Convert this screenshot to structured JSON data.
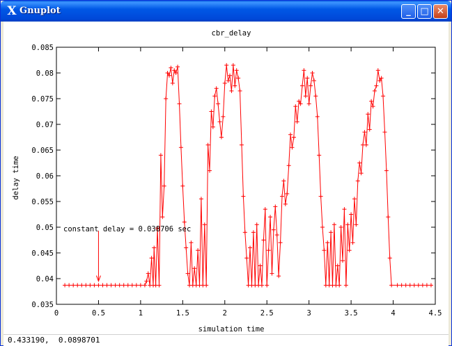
{
  "window": {
    "title": "Gnuplot",
    "app_icon": "x-window-icon",
    "controls": {
      "minimize": "minimize-icon",
      "maximize": "maximize-icon",
      "close": "close-icon"
    }
  },
  "status_bar": {
    "coordinates": "0.433190,  0.0898701"
  },
  "colors": {
    "series": "#ff0000",
    "titlebar": "#0054e3"
  },
  "chart_data": {
    "type": "line",
    "title": "cbr_delay",
    "xlabel": "simulation time",
    "ylabel": "delay time",
    "xlim": [
      0,
      4.5
    ],
    "ylim": [
      0.035,
      0.085
    ],
    "xticks": [
      "0",
      "0.5",
      "1",
      "1.5",
      "2",
      "2.5",
      "3",
      "3.5",
      "4",
      "4.5"
    ],
    "yticks": [
      "0.035",
      "0.04",
      "0.045",
      "0.05",
      "0.055",
      "0.06",
      "0.065",
      "0.07",
      "0.075",
      "0.08",
      "0.085"
    ],
    "grid": false,
    "markers": "plus",
    "annotation": {
      "text": "constant delay = 0.038706 sec",
      "arrow_to": [
        0.5,
        0.0395
      ],
      "arrow_from": [
        0.5,
        0.0493
      ]
    },
    "series": [
      {
        "values": [
          [
            0.1,
            0.03871
          ],
          [
            0.15,
            0.03871
          ],
          [
            0.2,
            0.03871
          ],
          [
            0.25,
            0.03871
          ],
          [
            0.3,
            0.03871
          ],
          [
            0.35,
            0.03871
          ],
          [
            0.4,
            0.03871
          ],
          [
            0.45,
            0.03871
          ],
          [
            0.5,
            0.03871
          ],
          [
            0.55,
            0.03871
          ],
          [
            0.6,
            0.03871
          ],
          [
            0.65,
            0.03871
          ],
          [
            0.7,
            0.03871
          ],
          [
            0.75,
            0.03871
          ],
          [
            0.8,
            0.03871
          ],
          [
            0.85,
            0.03871
          ],
          [
            0.9,
            0.03871
          ],
          [
            0.95,
            0.03871
          ],
          [
            1.0,
            0.03871
          ],
          [
            1.05,
            0.03871
          ],
          [
            1.07,
            0.0395
          ],
          [
            1.09,
            0.041
          ],
          [
            1.11,
            0.0387
          ],
          [
            1.13,
            0.044
          ],
          [
            1.15,
            0.0387
          ],
          [
            1.16,
            0.046
          ],
          [
            1.18,
            0.0387
          ],
          [
            1.2,
            0.0498
          ],
          [
            1.22,
            0.0387
          ],
          [
            1.24,
            0.064
          ],
          [
            1.26,
            0.052
          ],
          [
            1.28,
            0.058
          ],
          [
            1.3,
            0.075
          ],
          [
            1.32,
            0.08
          ],
          [
            1.34,
            0.0795
          ],
          [
            1.36,
            0.081
          ],
          [
            1.38,
            0.078
          ],
          [
            1.4,
            0.0805
          ],
          [
            1.42,
            0.08
          ],
          [
            1.44,
            0.0812
          ],
          [
            1.46,
            0.074
          ],
          [
            1.48,
            0.0655
          ],
          [
            1.5,
            0.058
          ],
          [
            1.52,
            0.051
          ],
          [
            1.54,
            0.046
          ],
          [
            1.56,
            0.041
          ],
          [
            1.58,
            0.0387
          ],
          [
            1.6,
            0.047
          ],
          [
            1.62,
            0.0387
          ],
          [
            1.64,
            0.042
          ],
          [
            1.66,
            0.0387
          ],
          [
            1.68,
            0.0455
          ],
          [
            1.7,
            0.0387
          ],
          [
            1.72,
            0.0555
          ],
          [
            1.74,
            0.0387
          ],
          [
            1.76,
            0.0505
          ],
          [
            1.78,
            0.0387
          ],
          [
            1.8,
            0.066
          ],
          [
            1.82,
            0.061
          ],
          [
            1.84,
            0.0725
          ],
          [
            1.86,
            0.0695
          ],
          [
            1.88,
            0.0755
          ],
          [
            1.9,
            0.077
          ],
          [
            1.92,
            0.074
          ],
          [
            1.94,
            0.0705
          ],
          [
            1.96,
            0.0675
          ],
          [
            1.98,
            0.0715
          ],
          [
            2.0,
            0.078
          ],
          [
            2.02,
            0.0815
          ],
          [
            2.04,
            0.0785
          ],
          [
            2.06,
            0.0795
          ],
          [
            2.08,
            0.0765
          ],
          [
            2.1,
            0.0815
          ],
          [
            2.12,
            0.0775
          ],
          [
            2.14,
            0.0805
          ],
          [
            2.16,
            0.079
          ],
          [
            2.18,
            0.0765
          ],
          [
            2.2,
            0.066
          ],
          [
            2.22,
            0.056
          ],
          [
            2.24,
            0.049
          ],
          [
            2.26,
            0.044
          ],
          [
            2.28,
            0.0387
          ],
          [
            2.3,
            0.046
          ],
          [
            2.32,
            0.0387
          ],
          [
            2.34,
            0.049
          ],
          [
            2.36,
            0.0387
          ],
          [
            2.38,
            0.0505
          ],
          [
            2.4,
            0.0387
          ],
          [
            2.42,
            0.0425
          ],
          [
            2.44,
            0.0387
          ],
          [
            2.46,
            0.0475
          ],
          [
            2.48,
            0.0535
          ],
          [
            2.5,
            0.0387
          ],
          [
            2.52,
            0.0455
          ],
          [
            2.54,
            0.052
          ],
          [
            2.56,
            0.041
          ],
          [
            2.58,
            0.0495
          ],
          [
            2.6,
            0.054
          ],
          [
            2.62,
            0.0485
          ],
          [
            2.64,
            0.0405
          ],
          [
            2.66,
            0.047
          ],
          [
            2.68,
            0.056
          ],
          [
            2.7,
            0.059
          ],
          [
            2.72,
            0.0545
          ],
          [
            2.74,
            0.0565
          ],
          [
            2.76,
            0.062
          ],
          [
            2.78,
            0.068
          ],
          [
            2.8,
            0.0655
          ],
          [
            2.82,
            0.0675
          ],
          [
            2.84,
            0.0735
          ],
          [
            2.86,
            0.0705
          ],
          [
            2.88,
            0.0745
          ],
          [
            2.9,
            0.074
          ],
          [
            2.92,
            0.0775
          ],
          [
            2.94,
            0.0805
          ],
          [
            2.96,
            0.0755
          ],
          [
            2.98,
            0.079
          ],
          [
            3.0,
            0.074
          ],
          [
            3.02,
            0.0775
          ],
          [
            3.04,
            0.08
          ],
          [
            3.06,
            0.0785
          ],
          [
            3.08,
            0.0755
          ],
          [
            3.1,
            0.0715
          ],
          [
            3.12,
            0.064
          ],
          [
            3.14,
            0.056
          ],
          [
            3.16,
            0.05
          ],
          [
            3.18,
            0.0455
          ],
          [
            3.2,
            0.0387
          ],
          [
            3.22,
            0.047
          ],
          [
            3.24,
            0.0387
          ],
          [
            3.26,
            0.049
          ],
          [
            3.28,
            0.0387
          ],
          [
            3.3,
            0.0505
          ],
          [
            3.32,
            0.0387
          ],
          [
            3.34,
            0.0425
          ],
          [
            3.36,
            0.0387
          ],
          [
            3.38,
            0.05
          ],
          [
            3.4,
            0.0435
          ],
          [
            3.42,
            0.0535
          ],
          [
            3.44,
            0.0387
          ],
          [
            3.46,
            0.0505
          ],
          [
            3.48,
            0.0455
          ],
          [
            3.5,
            0.0525
          ],
          [
            3.52,
            0.047
          ],
          [
            3.54,
            0.0555
          ],
          [
            3.56,
            0.0505
          ],
          [
            3.58,
            0.059
          ],
          [
            3.6,
            0.0625
          ],
          [
            3.62,
            0.0605
          ],
          [
            3.64,
            0.066
          ],
          [
            3.66,
            0.0685
          ],
          [
            3.68,
            0.066
          ],
          [
            3.7,
            0.072
          ],
          [
            3.72,
            0.069
          ],
          [
            3.74,
            0.0745
          ],
          [
            3.76,
            0.0735
          ],
          [
            3.78,
            0.0765
          ],
          [
            3.8,
            0.0775
          ],
          [
            3.82,
            0.0805
          ],
          [
            3.84,
            0.0785
          ],
          [
            3.86,
            0.079
          ],
          [
            3.88,
            0.0755
          ],
          [
            3.9,
            0.0685
          ],
          [
            3.92,
            0.061
          ],
          [
            3.94,
            0.052
          ],
          [
            3.96,
            0.044
          ],
          [
            3.98,
            0.03871
          ],
          [
            4.05,
            0.03871
          ],
          [
            4.1,
            0.03871
          ],
          [
            4.15,
            0.03871
          ],
          [
            4.2,
            0.03871
          ],
          [
            4.25,
            0.03871
          ],
          [
            4.3,
            0.03871
          ],
          [
            4.35,
            0.03871
          ],
          [
            4.4,
            0.03871
          ],
          [
            4.45,
            0.03871
          ]
        ]
      }
    ]
  }
}
